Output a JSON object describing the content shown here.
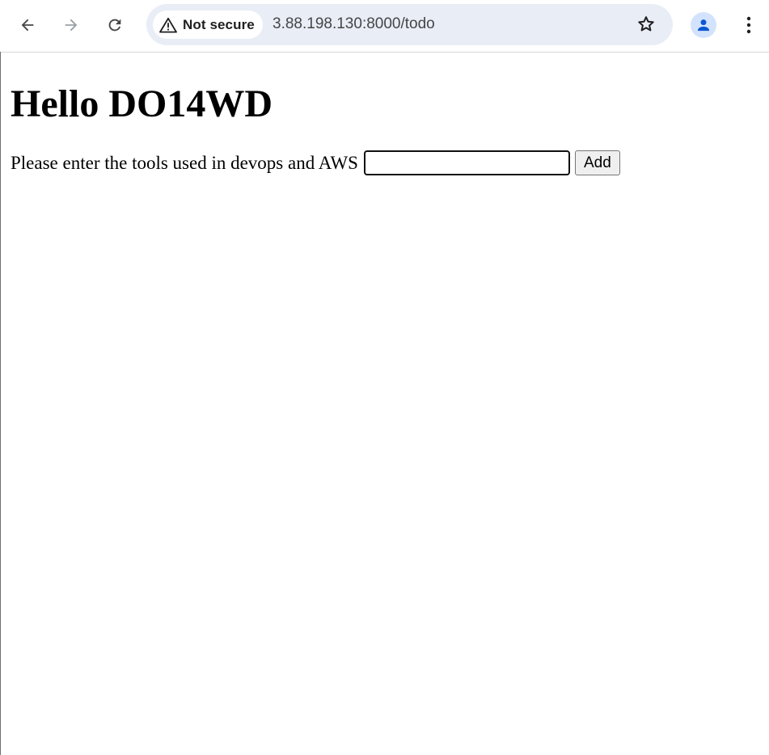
{
  "browser": {
    "security_label": "Not secure",
    "url": "3.88.198.130:8000/todo",
    "icons": {
      "back": "arrow-left-icon",
      "forward": "arrow-right-icon",
      "reload": "reload-icon",
      "security": "warning-triangle-icon",
      "bookmark": "star-icon",
      "profile": "person-icon",
      "menu": "kebab-menu-icon"
    },
    "colors": {
      "omnibox_bg": "#e9edf6",
      "profile_bg": "#d3e3fd",
      "profile_icon": "#0b57d0",
      "icon": "#444746",
      "icon_disabled": "#9aa0a6"
    }
  },
  "page": {
    "heading": "Hello DO14WD",
    "form": {
      "label": "Please enter the tools used in devops and AWS",
      "input_value": "",
      "button_label": "Add"
    }
  }
}
